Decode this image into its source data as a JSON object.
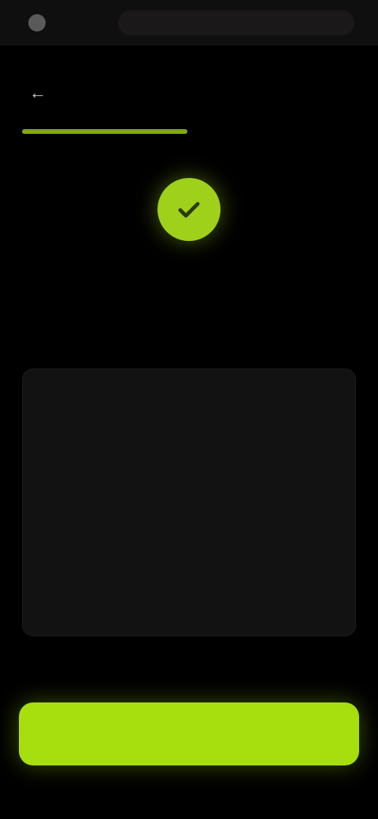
{
  "topbar": {
    "site_title": "",
    "url": ""
  },
  "header": {
    "back_icon": "arrow-left-icon",
    "title": ""
  },
  "progress": {
    "fraction": 0.5,
    "label": ""
  },
  "hero": {
    "icon": "check-icon",
    "title": "",
    "subtitle": ""
  },
  "card": {
    "heading": "",
    "paragraph_1": "",
    "paragraph_2": ""
  },
  "cta": {
    "label": ""
  },
  "colors": {
    "accent": "#a6df0d",
    "accent_dark": "#7fa814",
    "background": "#000000",
    "card": "#121212"
  }
}
